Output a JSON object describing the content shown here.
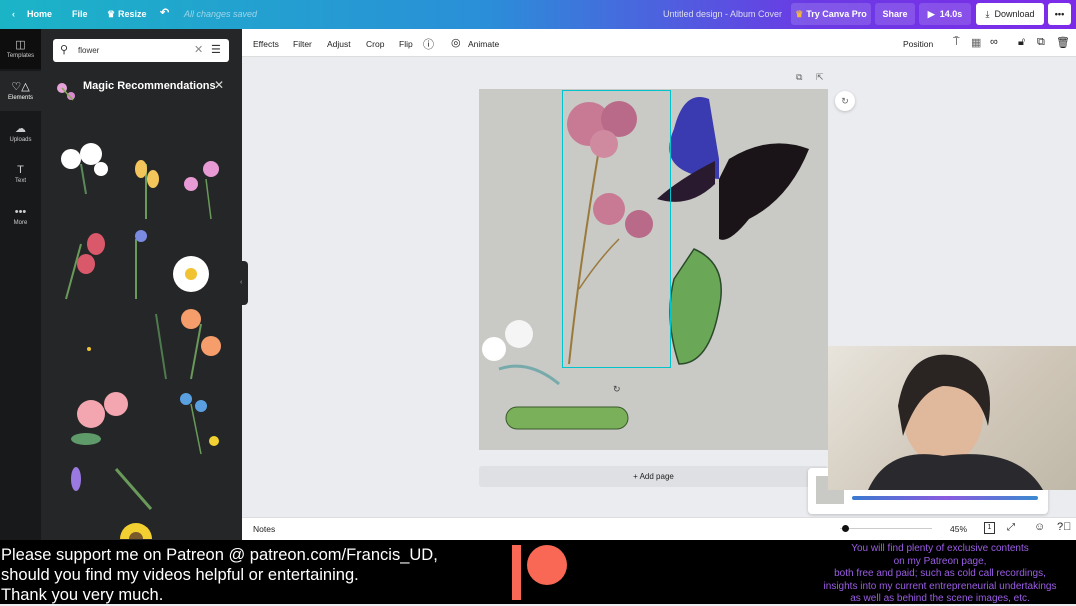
{
  "topbar": {
    "home": "Home",
    "file": "File",
    "resize": "Resize",
    "saved": "All changes saved",
    "title": "Untitled design - Album Cover",
    "try_pro": "Try Canva Pro",
    "share": "Share",
    "duration": "14.0s",
    "download": "Download",
    "more": "•••"
  },
  "rail": [
    {
      "label": "Templates",
      "icon": "templates-icon"
    },
    {
      "label": "Elements",
      "icon": "elements-icon"
    },
    {
      "label": "Uploads",
      "icon": "upload-icon"
    },
    {
      "label": "Text",
      "icon": "text-icon"
    },
    {
      "label": "More",
      "icon": "more-icon"
    }
  ],
  "panel": {
    "search_value": "flower",
    "magic_title": "Magic Recommendations"
  },
  "toolbar": {
    "effects": "Effects",
    "filter": "Filter",
    "adjust": "Adjust",
    "crop": "Crop",
    "flip": "Flip",
    "animate": "Animate",
    "position": "Position"
  },
  "canvas": {
    "add_page": "+ Add page"
  },
  "bottombar": {
    "notes": "Notes",
    "zoom": "45%",
    "page_number": "1",
    "zoom_fraction": 0.05
  },
  "banner": {
    "left_lines": [
      "Please support me on Patreon @ patreon.com/Francis_UD,",
      "should you find my videos helpful or entertaining.",
      "Thank you very much."
    ],
    "right_lines": [
      "You will find plenty of exclusive contents",
      "on my Patreon page,",
      "both free and paid; such as cold call recordings,",
      "insights into my current entrepreneurial undertakings",
      "as well as behind the scene images, etc."
    ],
    "patreon_color": "#f96854"
  },
  "colors": {
    "accent": "#7d2ae8",
    "selection": "#00c4cc"
  }
}
